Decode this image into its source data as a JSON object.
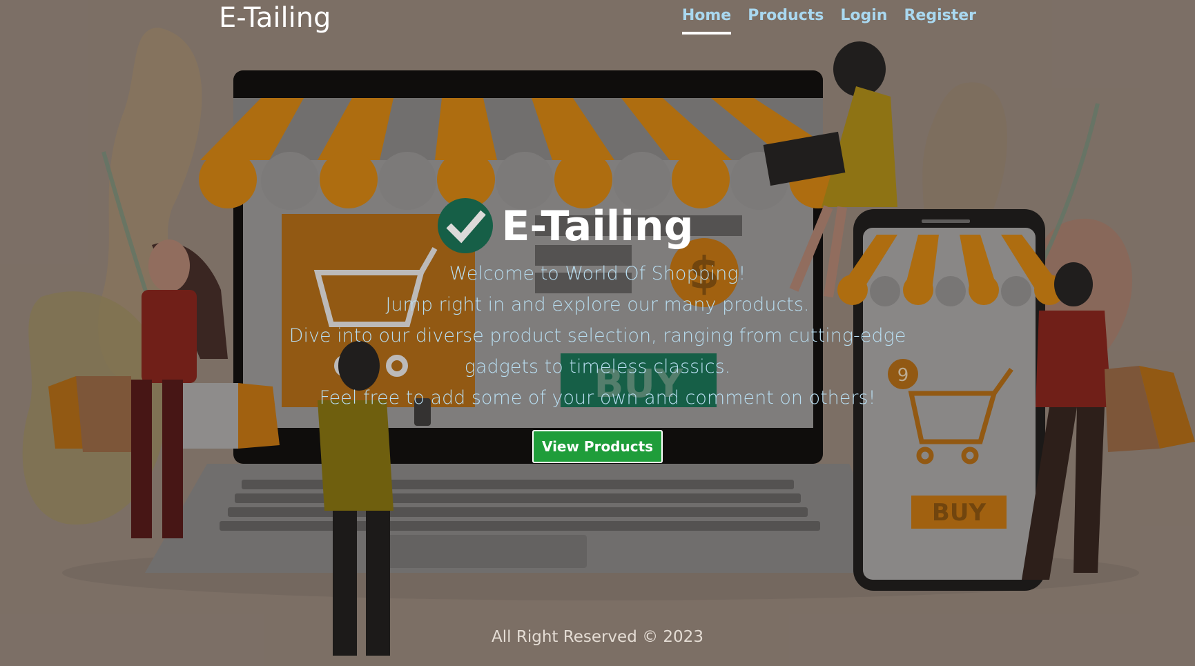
{
  "app": {
    "brand": "E-Tailing"
  },
  "nav": {
    "items": [
      {
        "label": "Home",
        "active": true
      },
      {
        "label": "Products",
        "active": false
      },
      {
        "label": "Login",
        "active": false
      },
      {
        "label": "Register",
        "active": false
      }
    ]
  },
  "hero": {
    "title": "E-Tailing",
    "lines": [
      "Welcome to World Of Shopping!",
      "Jump right in and explore our many products.",
      "Dive into our diverse product selection, ranging from cutting-edge gadgets to timeless classics.",
      "Feel free to add some of your own and comment on others!"
    ],
    "button_label": "View Products"
  },
  "illustration": {
    "buy_label_laptop": "BUY",
    "buy_label_phone": "BUY",
    "cart_badge": "9",
    "dollar_sign": "$"
  },
  "footer": {
    "text": "All Right Reserved © 2023"
  },
  "colors": {
    "background": "#8a7d72",
    "nav_link": "#a9d8f0",
    "hero_text": "#b8ddf0",
    "button": "#1f9d3a",
    "awning_orange": "#c77b0a",
    "awning_grey": "#7c7c7c"
  }
}
